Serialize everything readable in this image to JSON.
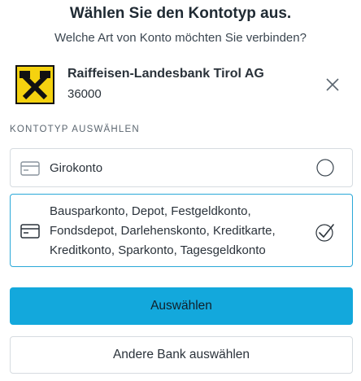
{
  "header": {
    "title": "Wählen Sie den Kontotyp aus.",
    "subtitle": "Welche Art von Konto möchten Sie verbinden?"
  },
  "bank": {
    "name": "Raiffeisen-Landesbank Tirol AG",
    "code": "36000",
    "logo_color": "#f5d20f",
    "logo_icon": "raiffeisen-gable-cross"
  },
  "section": {
    "label": "KONTOTYP AUSWÄHLEN"
  },
  "options": [
    {
      "label": "Girokonto",
      "icon": "card-icon",
      "selected": false
    },
    {
      "label": "Bausparkonto, Depot, Festgeldkonto, Fondsdepot, Darlehenskonto, Kreditkarte, Kreditkonto, Sparkonto, Tagesgeldkonto",
      "icon": "card-icon",
      "selected": true
    }
  ],
  "buttons": {
    "primary_label": "Auswählen",
    "secondary_label": "Andere Bank auswählen"
  },
  "colors": {
    "accent": "#13a8dc",
    "selected_border": "#2aa8d8"
  }
}
